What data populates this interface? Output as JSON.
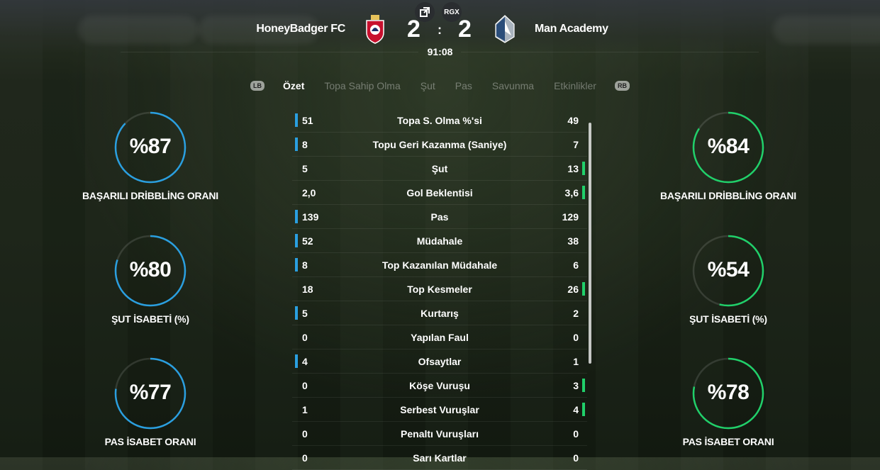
{
  "top_icons": {
    "rgx_label": "RGX"
  },
  "match": {
    "home_team": "HoneyBadger FC",
    "away_team": "Man Academy",
    "home_score": "2",
    "away_score": "2",
    "separator": ":",
    "clock": "91:08"
  },
  "tabs": {
    "left_bumper": "LB",
    "right_bumper": "RB",
    "items": [
      "Özet",
      "Topa Sahip Olma",
      "Şut",
      "Pas",
      "Savunma",
      "Etkinlikler"
    ],
    "active": "Özet"
  },
  "colors": {
    "home_accent": "#2a9fe0",
    "away_accent": "#20d06a"
  },
  "home_gauges": [
    {
      "value": "%87",
      "fraction": 0.87,
      "label": "BAŞARILI DRİBBLİNG ORANI"
    },
    {
      "value": "%80",
      "fraction": 0.8,
      "label": "ŞUT İSABETİ (%)"
    },
    {
      "value": "%77",
      "fraction": 0.77,
      "label": "PAS İSABET ORANI"
    }
  ],
  "away_gauges": [
    {
      "value": "%84",
      "fraction": 0.84,
      "label": "BAŞARILI DRİBBLİNG ORANI"
    },
    {
      "value": "%54",
      "fraction": 0.54,
      "label": "ŞUT İSABETİ (%)"
    },
    {
      "value": "%78",
      "fraction": 0.78,
      "label": "PAS İSABET ORANI"
    }
  ],
  "stats": [
    {
      "home": "51",
      "name": "Topa S. Olma %'si",
      "away": "49",
      "leader": "home"
    },
    {
      "home": "8",
      "name": "Topu Geri Kazanma (Saniye)",
      "away": "7",
      "leader": "home"
    },
    {
      "home": "5",
      "name": "Şut",
      "away": "13",
      "leader": "away"
    },
    {
      "home": "2,0",
      "name": "Gol Beklentisi",
      "away": "3,6",
      "leader": "away"
    },
    {
      "home": "139",
      "name": "Pas",
      "away": "129",
      "leader": "home"
    },
    {
      "home": "52",
      "name": "Müdahale",
      "away": "38",
      "leader": "home"
    },
    {
      "home": "8",
      "name": "Top Kazanılan Müdahale",
      "away": "6",
      "leader": "home"
    },
    {
      "home": "18",
      "name": "Top Kesmeler",
      "away": "26",
      "leader": "away"
    },
    {
      "home": "5",
      "name": "Kurtarış",
      "away": "2",
      "leader": "home"
    },
    {
      "home": "0",
      "name": "Yapılan Faul",
      "away": "0",
      "leader": "none"
    },
    {
      "home": "4",
      "name": "Ofsaytlar",
      "away": "1",
      "leader": "home"
    },
    {
      "home": "0",
      "name": "Köşe Vuruşu",
      "away": "3",
      "leader": "away"
    },
    {
      "home": "1",
      "name": "Serbest Vuruşlar",
      "away": "4",
      "leader": "away"
    },
    {
      "home": "0",
      "name": "Penaltı Vuruşları",
      "away": "0",
      "leader": "none"
    },
    {
      "home": "0",
      "name": "Sarı Kartlar",
      "away": "0",
      "leader": "none"
    }
  ]
}
